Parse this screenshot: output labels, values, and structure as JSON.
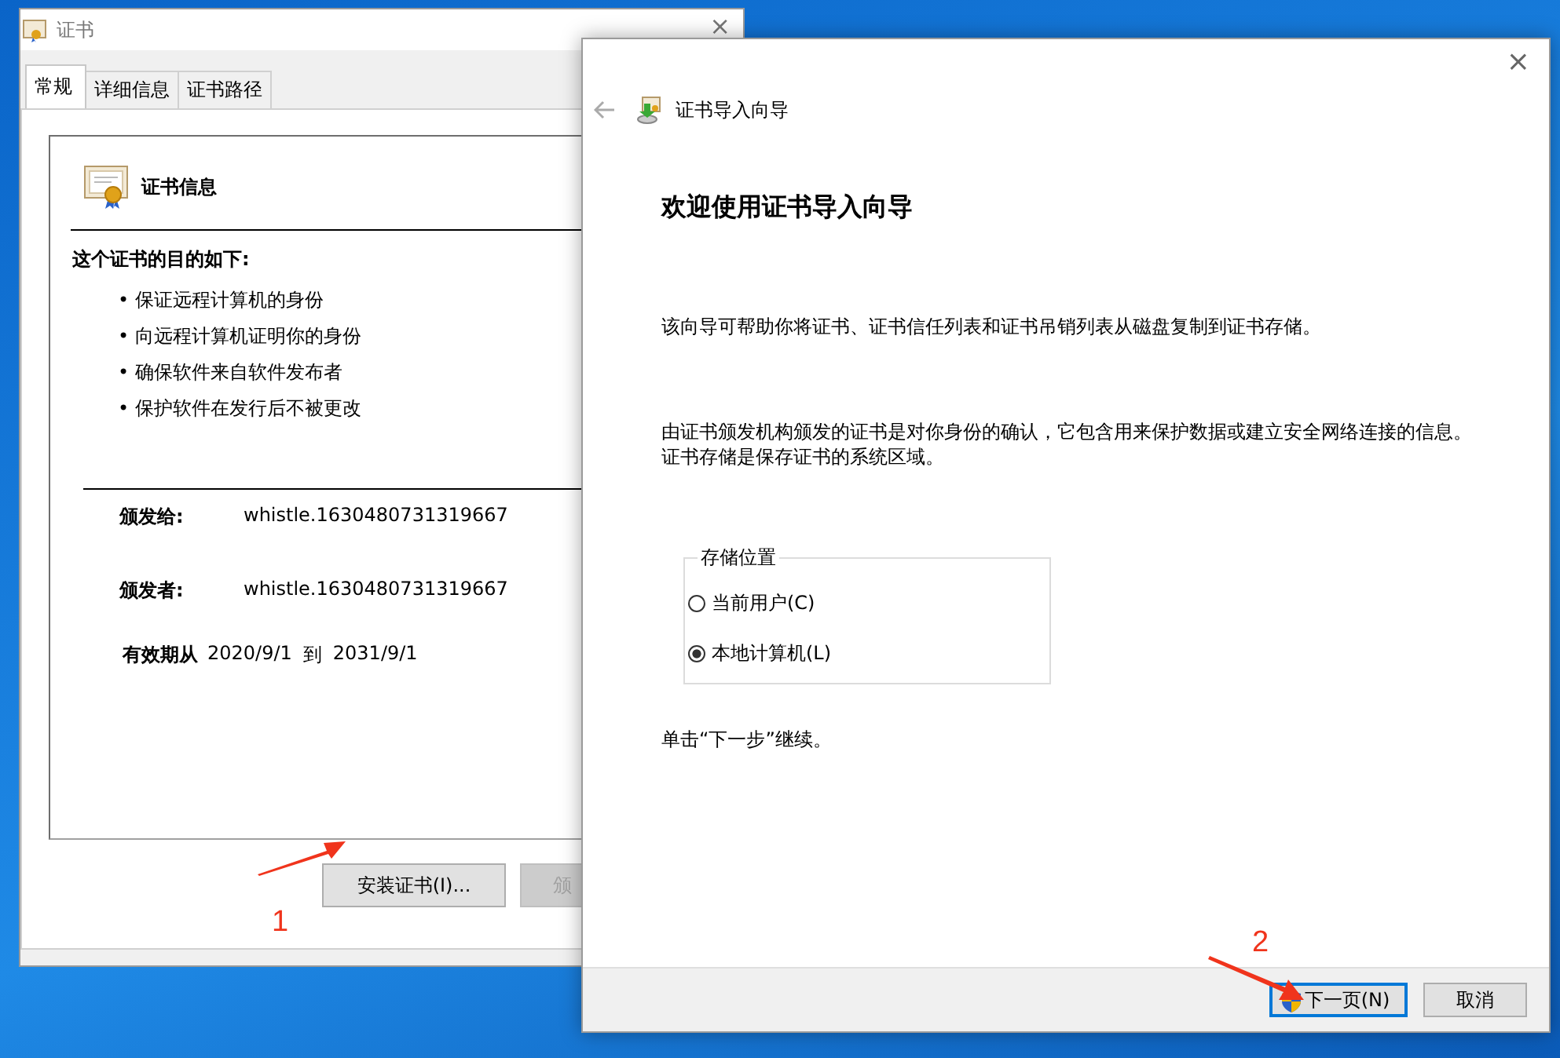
{
  "cert_window": {
    "title": "证书",
    "close": "×",
    "tabs": [
      {
        "label": "常规",
        "selected": true
      },
      {
        "label": "详细信息",
        "selected": false
      },
      {
        "label": "证书路径",
        "selected": false
      }
    ],
    "info_title": "证书信息",
    "purpose_heading": "这个证书的目的如下:",
    "purposes": [
      "• 保证远程计算机的身份",
      "• 向远程计算机证明你的身份",
      "• 确保软件来自软件发布者",
      "• 保护软件在发行后不被更改"
    ],
    "fields": [
      {
        "label": "颁发给:",
        "value": "whistle.1630480731319667"
      },
      {
        "label": "颁发者:",
        "value": "whistle.1630480731319667"
      }
    ],
    "validity": {
      "label": "有效期从",
      "from": "2020/9/1",
      "to_word": "到",
      "to": "2031/9/1"
    },
    "buttons": [
      {
        "label": "安装证书(I)...",
        "disabled": false
      },
      {
        "label": "颁",
        "disabled": true
      }
    ]
  },
  "wizard": {
    "title": "证书导入向导",
    "close": "×",
    "heading": "欢迎使用证书导入向导",
    "paragraphs": [
      "该向导可帮助你将证书、证书信任列表和证书吊销列表从磁盘复制到证书存储。",
      "由证书颁发机构颁发的证书是对你身份的确认，它包含用来保护数据或建立安全网络连接的信息。证书存储是保存证书的系统区域。"
    ],
    "store_group": {
      "legend": "存储位置",
      "options": [
        {
          "label": "当前用户(C)",
          "selected": false
        },
        {
          "label": "本地计算机(L)",
          "selected": true
        }
      ]
    },
    "hint": "单击“下一步”继续。",
    "buttons": [
      {
        "label": "下一页(N)",
        "default": true,
        "shield": true
      },
      {
        "label": "取消",
        "default": false,
        "shield": false
      }
    ]
  },
  "annotations": [
    {
      "label": "1",
      "kind": "arrow-left"
    },
    {
      "label": "2",
      "kind": "arrow-right"
    }
  ]
}
